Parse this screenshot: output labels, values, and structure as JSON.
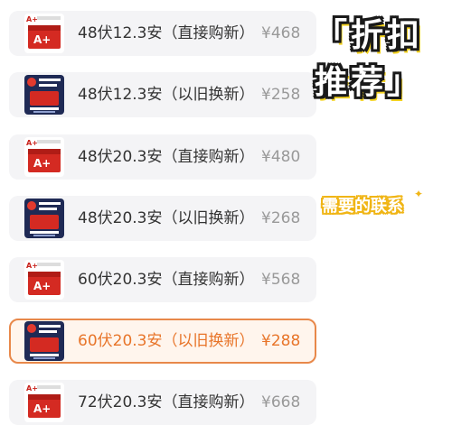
{
  "options": [
    {
      "label": "48伏12.3安（直接购新）",
      "price": "¥468",
      "kind": "new",
      "selected": false
    },
    {
      "label": "48伏12.3安（以旧换新）",
      "price": "¥258",
      "kind": "tradein",
      "selected": false
    },
    {
      "label": "48伏20.3安（直接购新）",
      "price": "¥480",
      "kind": "new",
      "selected": false
    },
    {
      "label": "48伏20.3安（以旧换新）",
      "price": "¥268",
      "kind": "tradein",
      "selected": false
    },
    {
      "label": "60伏20.3安（直接购新）",
      "price": "¥568",
      "kind": "new",
      "selected": false
    },
    {
      "label": "60伏20.3安（以旧换新）",
      "price": "¥288",
      "kind": "tradein",
      "selected": true
    },
    {
      "label": "72伏20.3安（直接购新）",
      "price": "¥668",
      "kind": "new",
      "selected": false
    }
  ],
  "promo": {
    "line1": "「折扣",
    "line2": "推荐」"
  },
  "contact": {
    "text": "需要的联系",
    "sparkle": "✦"
  },
  "thumb_logo": "A+",
  "colors": {
    "row_bg": "#f4f4f6",
    "selected_border": "#e8884a",
    "selected_text": "#e8752a",
    "price_gray": "#999999",
    "promo_yellow": "#f4d320",
    "product_red": "#d42a22",
    "product_navy": "#1f2a55"
  }
}
